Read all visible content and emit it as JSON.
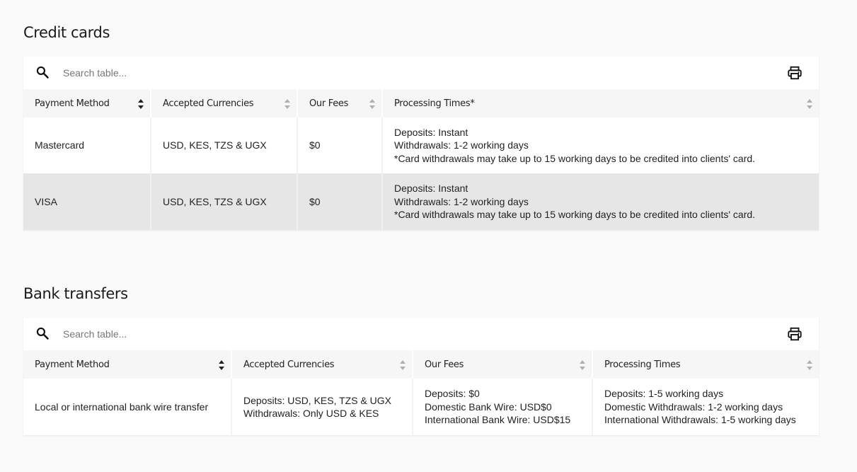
{
  "credit_cards": {
    "title": "Credit cards",
    "search_placeholder": "Search table...",
    "columns": [
      "Payment Method",
      "Accepted Currencies",
      "Our Fees",
      "Processing Times*"
    ],
    "rows": [
      {
        "method": "Mastercard",
        "currencies": "USD, KES, TZS & UGX",
        "fees": "$0",
        "times": [
          "Deposits: Instant",
          "Withdrawals: 1-2 working days",
          "*Card withdrawals may take up to 15 working days to be credited into clients' card."
        ]
      },
      {
        "method": "VISA",
        "currencies": "USD, KES, TZS & UGX",
        "fees": "$0",
        "times": [
          "Deposits: Instant",
          "Withdrawals: 1-2 working days",
          "*Card withdrawals may take up to 15 working days to be credited into clients' card."
        ]
      }
    ]
  },
  "bank_transfers": {
    "title": "Bank transfers",
    "search_placeholder": "Search table...",
    "columns": [
      "Payment Method",
      "Accepted Currencies",
      "Our Fees",
      "Processing Times"
    ],
    "rows": [
      {
        "method": "Local or international bank wire transfer",
        "currencies": [
          "Deposits: USD, KES, TZS & UGX",
          "Withdrawals: Only USD & KES"
        ],
        "fees": [
          "Deposits: $0",
          "Domestic Bank Wire: USD$0",
          "International Bank Wire: USD$15"
        ],
        "times": [
          "Deposits: 1-5 working days",
          "Domestic Withdrawals: 1-2 working days",
          "International Withdrawals: 1-5 working days"
        ]
      }
    ]
  },
  "icons": {
    "search": "search-icon",
    "print": "print-icon",
    "sort": "sort-icon"
  },
  "colors": {
    "background": "#fafafa",
    "card": "#ffffff",
    "header_row": "#f6f6f6",
    "alt_row": "#e6e6e6",
    "icon": "#111111",
    "sort_inactive": "#b0b0b0"
  }
}
